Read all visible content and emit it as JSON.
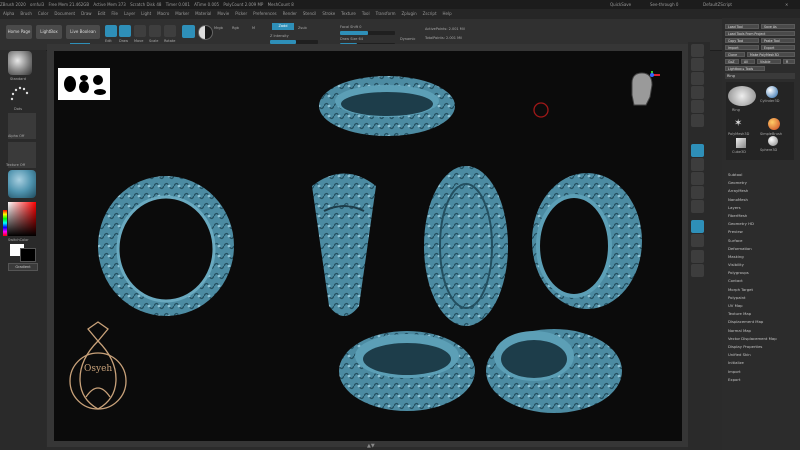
{
  "titlebar": {
    "items": [
      "ZBrush 2020",
      "ornful3",
      "Free Mem 21.462GB",
      "Active Mem 373",
      "Scratch Disk 48",
      "Timer 0.001",
      "ATime 0.005",
      "PolyCount 2.009 MP",
      "MeshCount 8"
    ],
    "right_items": [
      "QuickSave",
      "See-through 0",
      "DefaultZScript"
    ]
  },
  "menubar": {
    "items": [
      "Alpha",
      "Brush",
      "Color",
      "Document",
      "Draw",
      "Edit",
      "File",
      "Layer",
      "Light",
      "Macro",
      "Marker",
      "Material",
      "Movie",
      "Picker",
      "Preferences",
      "Render",
      "Stencil",
      "Stroke",
      "Texture",
      "Tool",
      "Transform",
      "Zplugin",
      "Zscript",
      "Help"
    ]
  },
  "topshelf": {
    "home_page": "Home Page",
    "lightbox": "LightBox",
    "live_boolean": "Live Boolean",
    "edit": "Edit",
    "draw": "Draw",
    "move": "Move",
    "scale": "Scale",
    "rotate": "Rotate",
    "mrgb": "Mrgb",
    "rgb": "Rgb",
    "m": "M",
    "zadd": "Zadd",
    "zsub": "Zsub",
    "z_intensity": "Z Intensity",
    "focal_shift": "Focal Shift 0",
    "draw_size": "Draw Size 64",
    "dynamic": "Dynamic",
    "active_points": "ActivePoints: 2.001 Mil",
    "total_points": "TotalPoints: 2.001 Mil"
  },
  "leftshelf": {
    "standard": "Standard",
    "dots": "Dots",
    "alpha_off": "Alpha Off",
    "texture_off": "Texture Off",
    "material": "MatCap Gray",
    "switch_color": "SwitchColor",
    "gradient": "Gradient"
  },
  "rightshelf": {
    "buttons": [
      "BPR",
      "SPix 3",
      "Persp",
      "Floor",
      "Local",
      "L.Sym",
      "Frame",
      "Move",
      "Zoom3D",
      "Rotate",
      "Line Fill PolyF",
      "Transp",
      "Ghost",
      "Solo",
      "Xpose"
    ]
  },
  "tray": {
    "top_buttons": [
      "Load Tool",
      "Save As",
      "Load Tools From Project",
      "Copy Tool",
      "Paste Tool",
      "Import",
      "Export",
      "Clone",
      "Make PolyMesh3D",
      "GoZ",
      "All",
      "Visible",
      "R",
      "Lightbox",
      "Tools"
    ],
    "tool_name": "Ring",
    "subtools": [
      "Ring",
      "Cylinder3D",
      "PolyMesh3D",
      "SimpleBrush",
      "Sphere3D",
      "Cube3D"
    ],
    "items": [
      "Subtool",
      "Geometry",
      "ArrayMesh",
      "NanoMesh",
      "Layers",
      "FiberMesh",
      "Geometry HD",
      "Preview",
      "Surface",
      "Deformation",
      "Masking",
      "Visibility",
      "Polygroups",
      "Contact",
      "Morph Target",
      "Polypaint",
      "UV Map",
      "Texture Map",
      "Displacement Map",
      "Normal Map",
      "Vector Displacement Map",
      "Display Properties",
      "Unified Skin",
      "Initialize",
      "Import",
      "Export"
    ]
  },
  "logo": {
    "brand": "Osyeh"
  },
  "colors": {
    "ring": "#5a9ab0",
    "ring_dark": "#2c5c6e",
    "accent": "#2e8fb8",
    "logo_gold": "#c9a27a"
  }
}
